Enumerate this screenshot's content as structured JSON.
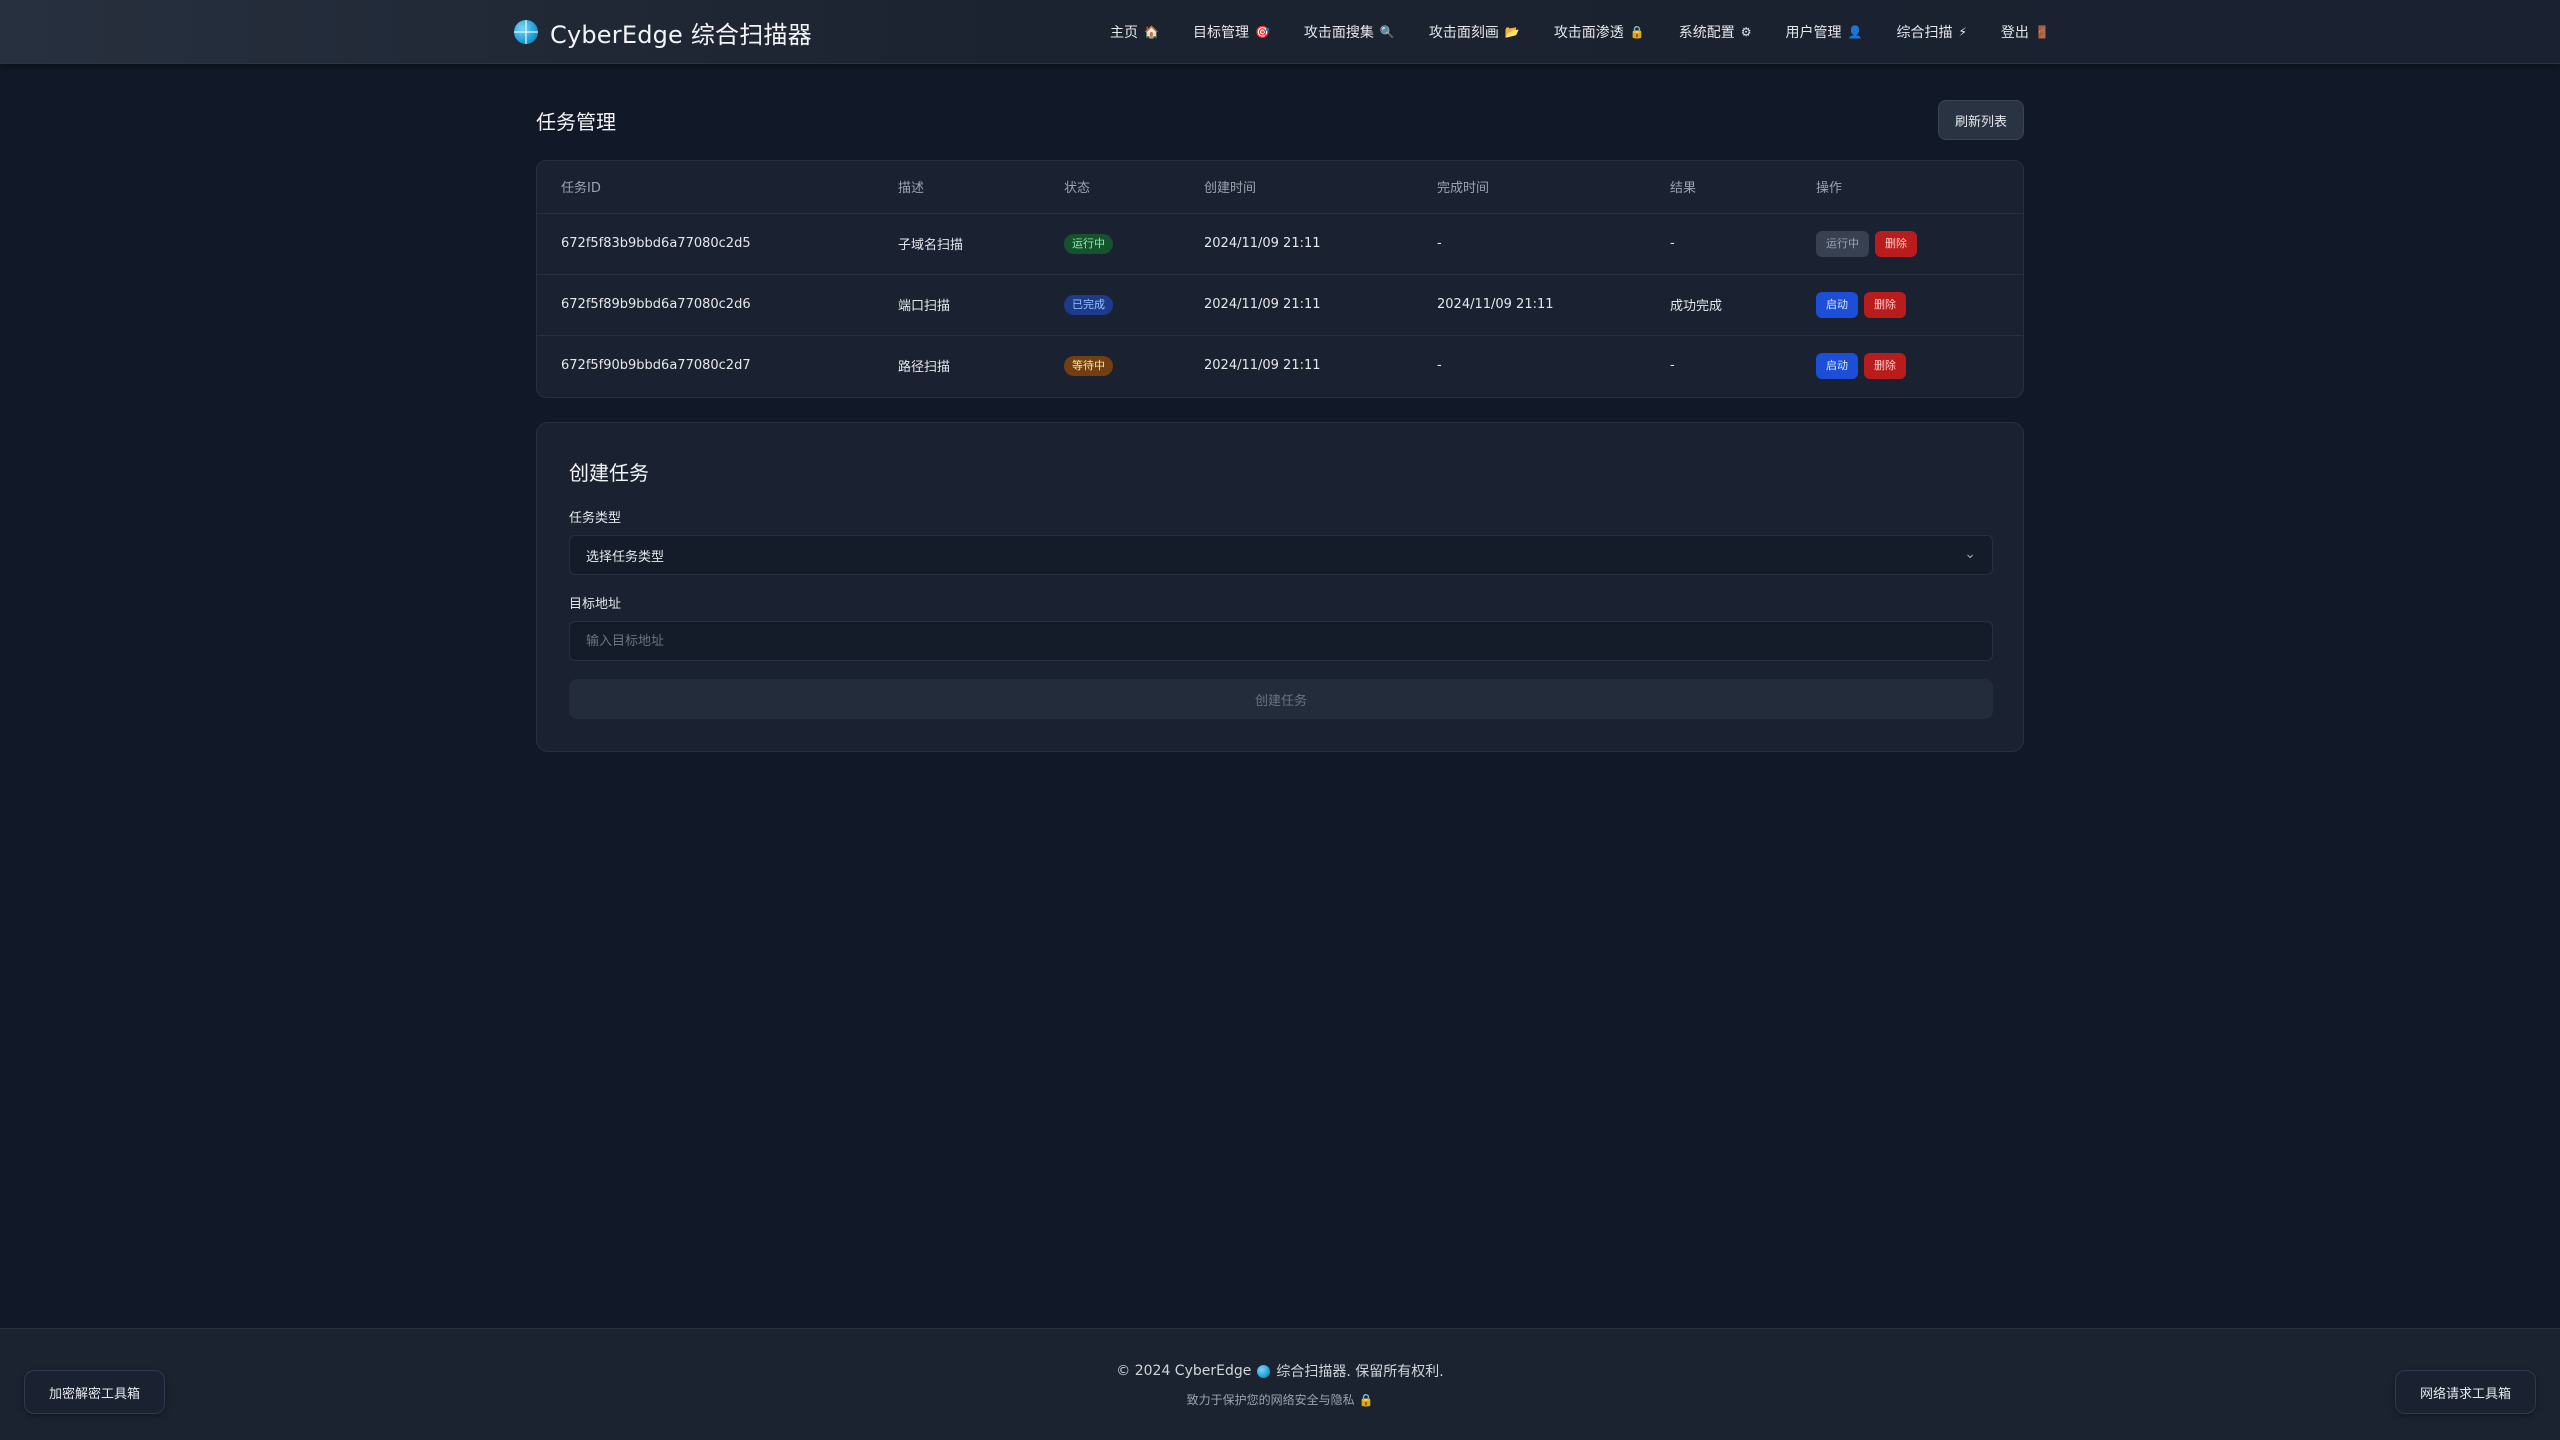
{
  "header": {
    "brand": "CyberEdge 综合扫描器",
    "nav": [
      {
        "label": "主页",
        "icon": "🏠",
        "icon_name": "home-icon"
      },
      {
        "label": "目标管理",
        "icon": "🎯",
        "icon_name": "target-icon"
      },
      {
        "label": "攻击面搜集",
        "icon": "🔍",
        "icon_name": "search-icon"
      },
      {
        "label": "攻击面刻画",
        "icon": "📂",
        "icon_name": "folder-icon"
      },
      {
        "label": "攻击面渗透",
        "icon": "🔒",
        "icon_name": "lock-icon"
      },
      {
        "label": "系统配置",
        "icon": "⚙",
        "icon_name": "gear-icon"
      },
      {
        "label": "用户管理",
        "icon": "👤",
        "icon_name": "user-icon"
      },
      {
        "label": "综合扫描",
        "icon": "⚡",
        "icon_name": "lightning-icon"
      },
      {
        "label": "登出",
        "icon": "🚪",
        "icon_name": "door-icon"
      }
    ]
  },
  "main": {
    "title": "任务管理",
    "refresh_label": "刷新列表",
    "table": {
      "columns": [
        "任务ID",
        "描述",
        "状态",
        "创建时间",
        "完成时间",
        "结果",
        "操作"
      ],
      "rows": [
        {
          "id": "672f5f83b9bbd6a77080c2d5",
          "desc": "子域名扫描",
          "status": "运行中",
          "created": "2024/11/09 21:11",
          "finished": "-",
          "result": "-",
          "action_primary": "运行中",
          "action_delete": "删除"
        },
        {
          "id": "672f5f89b9bbd6a77080c2d6",
          "desc": "端口扫描",
          "status": "已完成",
          "created": "2024/11/09 21:11",
          "finished": "2024/11/09 21:11",
          "result": "成功完成",
          "action_primary": "启动",
          "action_delete": "删除"
        },
        {
          "id": "672f5f90b9bbd6a77080c2d7",
          "desc": "路径扫描",
          "status": "等待中",
          "created": "2024/11/09 21:11",
          "finished": "-",
          "result": "-",
          "action_primary": "启动",
          "action_delete": "删除"
        }
      ]
    },
    "create": {
      "title": "创建任务",
      "type_label": "任务类型",
      "type_selected": "选择任务类型",
      "target_label": "目标地址",
      "target_placeholder": "输入目标地址",
      "target_value": "",
      "submit_label": "创建任务"
    }
  },
  "footer": {
    "copyright_prefix": "© 2024 CyberEdge",
    "copyright_suffix": "综合扫描器. 保留所有权利.",
    "tagline": "致力于保护您的网络安全与隐私",
    "tagline_icon": "🔒",
    "left_tool": "加密解密工具箱",
    "right_tool": "网络请求工具箱"
  },
  "colors": {
    "background": "#111827",
    "card": "#1a2232",
    "accent_blue": "#1d4ed8",
    "danger": "#b91c1c",
    "running_badge": "#14532d",
    "done_badge": "#1e3a8a",
    "waiting_badge": "#713f12"
  }
}
